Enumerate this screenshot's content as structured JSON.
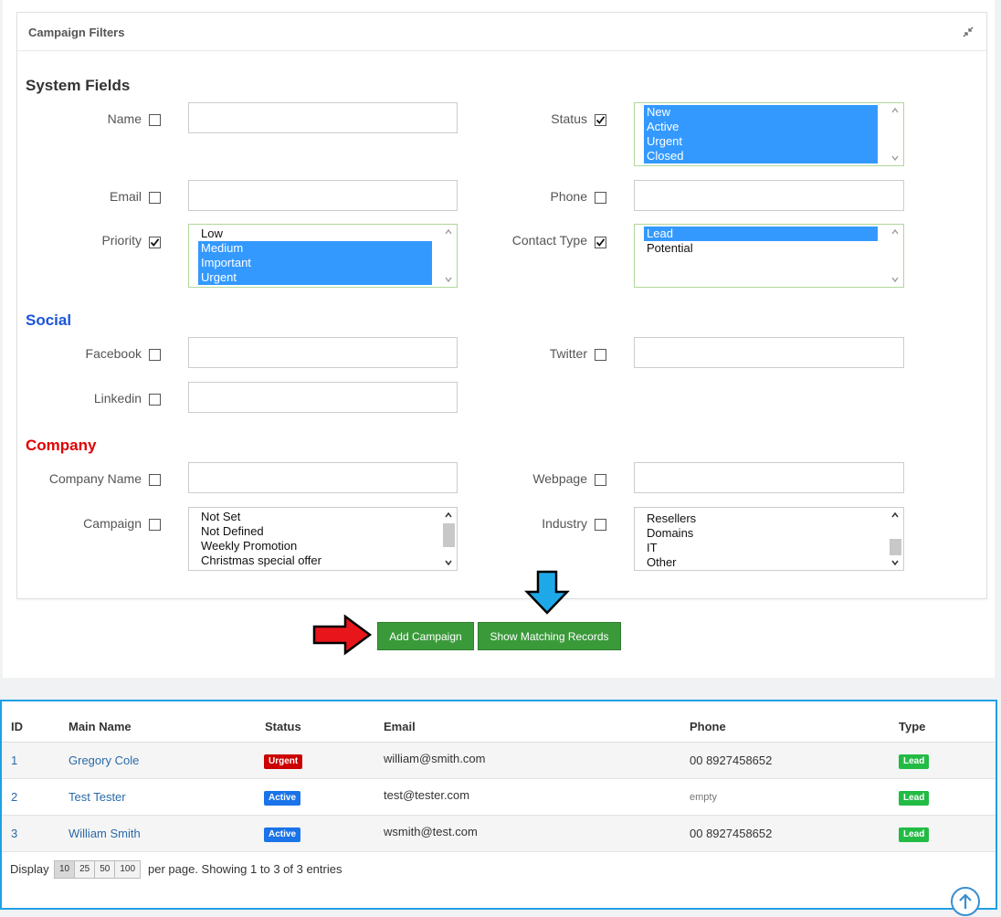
{
  "panel": {
    "title": "Campaign Filters"
  },
  "sections": {
    "system": "System Fields",
    "social": "Social",
    "company": "Company"
  },
  "fields": {
    "name": "Name",
    "status": "Status",
    "email": "Email",
    "phone": "Phone",
    "priority": "Priority",
    "contact_type": "Contact Type",
    "facebook": "Facebook",
    "twitter": "Twitter",
    "linkedin": "Linkedin",
    "company_name": "Company Name",
    "webpage": "Webpage",
    "campaign": "Campaign",
    "industry": "Industry"
  },
  "checkboxes": {
    "name": false,
    "status": true,
    "email": false,
    "phone": false,
    "priority": true,
    "contact_type": true,
    "facebook": false,
    "twitter": false,
    "linkedin": false,
    "company_name": false,
    "webpage": false,
    "campaign": false,
    "industry": false
  },
  "lists": {
    "status": [
      "New",
      "Active",
      "Urgent",
      "Closed"
    ],
    "priority": [
      "Low",
      "Medium",
      "Important",
      "Urgent"
    ],
    "contact_type": [
      "Lead",
      "Potential"
    ],
    "campaign": [
      "Not Set",
      "Not Defined",
      "Weekly Promotion",
      "Christmas special offer"
    ],
    "industry": [
      "Resellers",
      "Domains",
      "IT",
      "Other"
    ]
  },
  "buttons": {
    "add_campaign": "Add Campaign",
    "show_matching": "Show Matching Records"
  },
  "table": {
    "headers": [
      "ID",
      "Main Name",
      "Status",
      "Email",
      "Phone",
      "Type"
    ],
    "rows": [
      {
        "id": "1",
        "name": "Gregory Cole",
        "status": "Urgent",
        "email": "william@smith.com",
        "phone": "00 8927458652",
        "type": "Lead"
      },
      {
        "id": "2",
        "name": "Test Tester",
        "status": "Active",
        "email": "test@tester.com",
        "phone": "empty",
        "type": "Lead"
      },
      {
        "id": "3",
        "name": "William Smith",
        "status": "Active",
        "email": "wsmith@test.com",
        "phone": "00 8927458652",
        "type": "Lead"
      }
    ],
    "footer": {
      "display": "Display",
      "page_sizes": [
        "10",
        "25",
        "50",
        "100"
      ],
      "summary": "per page. Showing 1 to 3 of 3 entries"
    }
  },
  "colors": {
    "button_green": "#3a9a3a",
    "highlight_border": "#1ea0e4",
    "select_blue": "#3399ff",
    "social": "#1a56db",
    "company": "#e00000"
  }
}
